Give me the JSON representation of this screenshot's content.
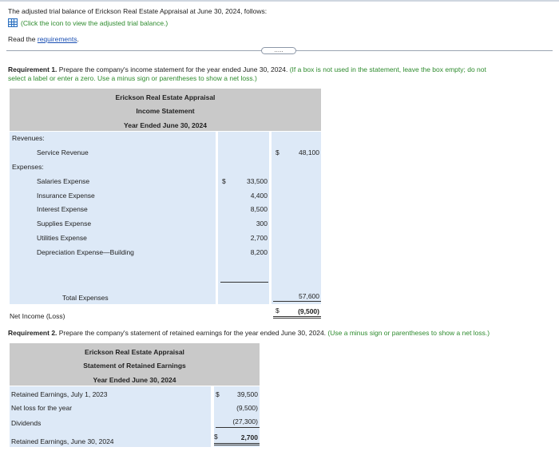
{
  "header": {
    "intro": "The adjusted trial balance of Erickson Real Estate Appraisal at June 30, 2024, follows:",
    "icon_link": "(Click the icon to view the adjusted trial balance.)",
    "read_prefix": "Read the ",
    "requirements_link": "requirements",
    "read_suffix": ".",
    "expander": "....."
  },
  "req1": {
    "label": "Requirement 1.",
    "text": " Prepare the company's income statement for the year ended June 30, 2024.",
    "hint1": " (If a box is not used in the statement, leave the box empty; do not",
    "hint2": "select a label or enter a zero. Use a minus sign or parentheses to show a net loss.)",
    "company": "Erickson Real Estate Appraisal",
    "statement": "Income Statement",
    "period": "Year Ended June 30, 2024",
    "revenues_label": "Revenues:",
    "service_revenue_label": "Service Revenue",
    "service_revenue_dollar": "$",
    "service_revenue": "48,100",
    "expenses_label": "Expenses:",
    "dollar_sign": "$",
    "expenses": [
      {
        "label": "Salaries Expense",
        "amount": "33,500"
      },
      {
        "label": "Insurance Expense",
        "amount": "4,400"
      },
      {
        "label": "Interest Expense",
        "amount": "8,500"
      },
      {
        "label": "Supplies Expense",
        "amount": "300"
      },
      {
        "label": "Utilities Expense",
        "amount": "2,700"
      },
      {
        "label": "Depreciation Expense—Building",
        "amount": "8,200"
      }
    ],
    "total_expenses_label": "Total Expenses",
    "total_expenses": "57,600",
    "net_income_label": "Net Income (Loss)",
    "net_income_dollar": "$",
    "net_income": "(9,500)"
  },
  "req2": {
    "label": "Requirement 2.",
    "text": " Prepare the company's statement of retained earnings for the year ended June 30, 2024.",
    "hint": " (Use a minus sign or parentheses to show a net loss.)",
    "company": "Erickson Real Estate Appraisal",
    "statement": "Statement of Retained Earnings",
    "period": "Year Ended June 30, 2024",
    "rows": [
      {
        "label": "Retained Earnings, July 1, 2023",
        "dollar": "$",
        "amount": "39,500"
      },
      {
        "label": "Net loss for the year",
        "dollar": "",
        "amount": "(9,500)"
      },
      {
        "label": "Dividends",
        "dollar": "",
        "amount": "(27,300)"
      },
      {
        "label": "Retained Earnings, June 30, 2024",
        "dollar": "$",
        "amount": "2,700"
      }
    ]
  }
}
